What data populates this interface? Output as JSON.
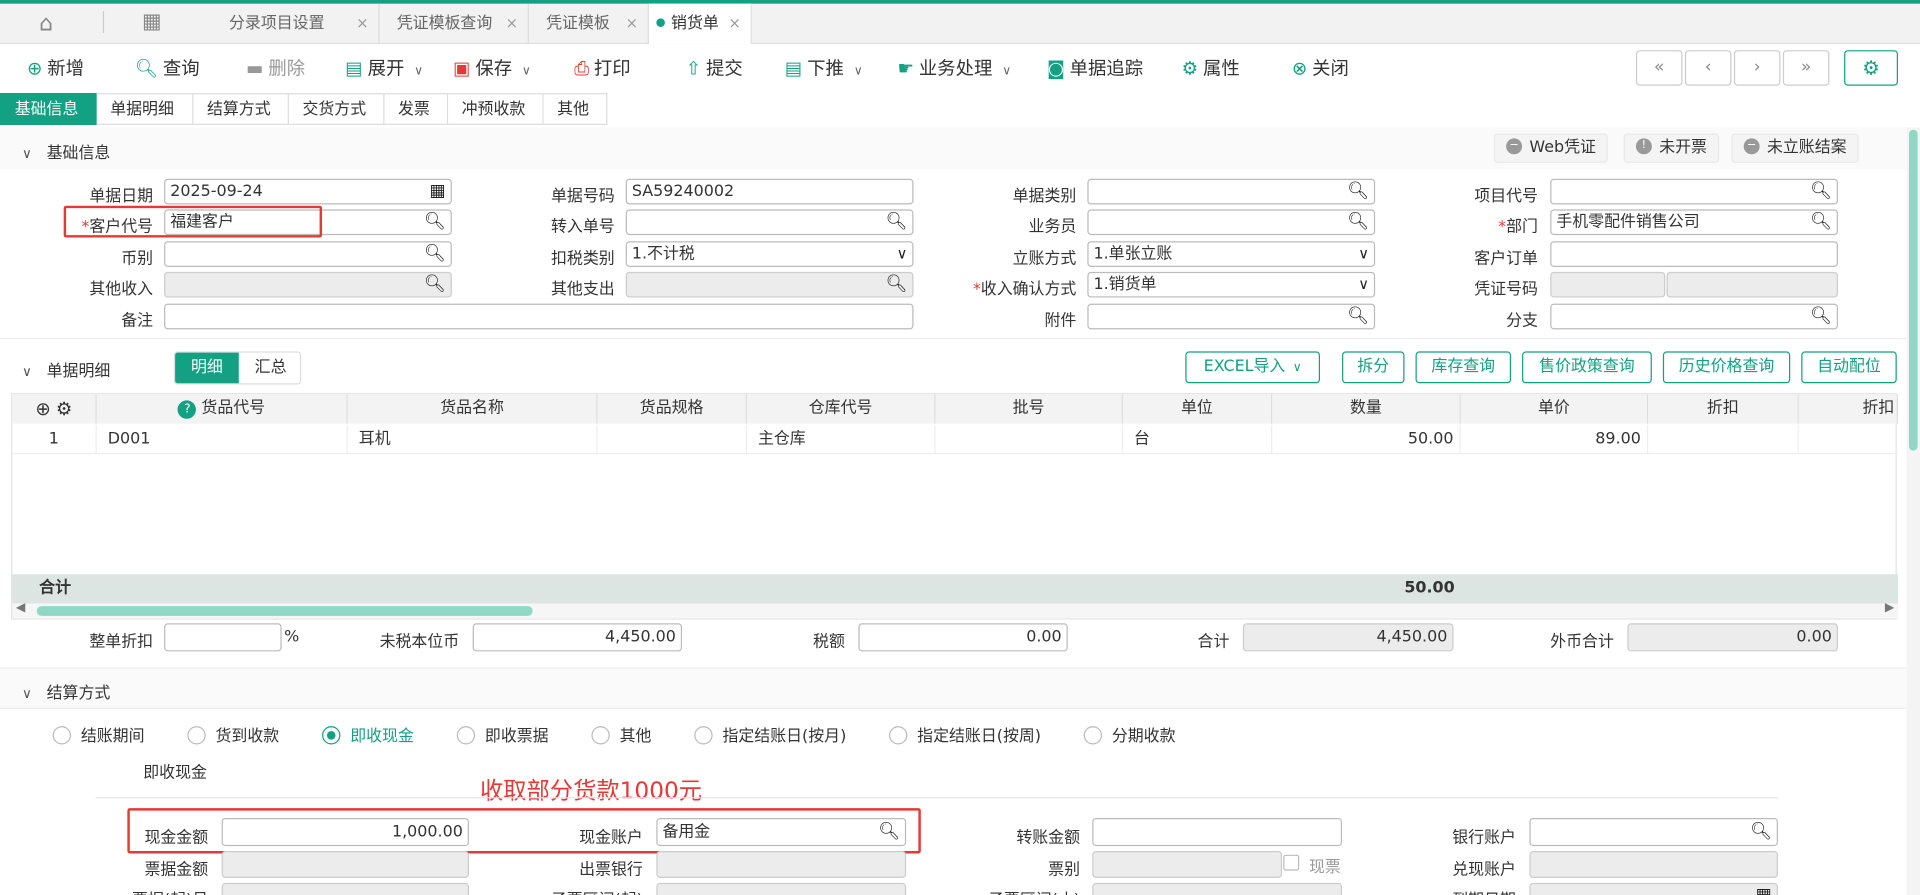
{
  "tabs": [
    {
      "label": "分录项目设置"
    },
    {
      "label": "凭证模板查询"
    },
    {
      "label": "凭证模板"
    },
    {
      "label": "销货单"
    }
  ],
  "toolbar": {
    "new": "新增",
    "query": "查询",
    "delete": "删除",
    "expand": "展开",
    "save": "保存",
    "print": "打印",
    "submit": "提交",
    "push_down": "下推",
    "business": "业务处理",
    "trace": "单据追踪",
    "properties": "属性",
    "close": "关闭"
  },
  "sub_tabs": [
    "基础信息",
    "单据明细",
    "结算方式",
    "交货方式",
    "发票",
    "冲预收款",
    "其他"
  ],
  "basic": {
    "section_title": "基础信息",
    "right_buttons": [
      "Web凭证",
      "未开票",
      "未立账结案"
    ],
    "labels": {
      "doc_date": "单据日期",
      "doc_no": "单据号码",
      "doc_type": "单据类别",
      "project_code": "项目代号",
      "customer_code": "客户代号",
      "transfer_no": "转入单号",
      "salesperson": "业务员",
      "department": "部门",
      "currency": "币别",
      "tax_type": "扣税类别",
      "account_method": "立账方式",
      "customer_order": "客户订单",
      "other_income": "其他收入",
      "other_expense": "其他支出",
      "revenue_confirm": "收入确认方式",
      "voucher_no": "凭证号码",
      "remark": "备注",
      "attachment": "附件",
      "branch": "分支"
    },
    "values": {
      "doc_date": "2025-09-24",
      "doc_no": "SA59240002",
      "customer_code": "福建客户",
      "department": "手机零配件销售公司",
      "tax_type": "1.不计税",
      "account_method": "1.单张立账",
      "revenue_confirm": "1.销货单"
    },
    "required_mark": "*"
  },
  "detail": {
    "section_title": "单据明细",
    "toggle": [
      "明细",
      "汇总"
    ],
    "buttons": [
      "EXCEL导入",
      "拆分",
      "库存查询",
      "售价政策查询",
      "历史价格查询",
      "自动配位"
    ],
    "columns": [
      "货品代号",
      "货品名称",
      "货品规格",
      "仓库代号",
      "批号",
      "单位",
      "数量",
      "单价",
      "折扣",
      "折扣"
    ],
    "rows": [
      {
        "idx": "1",
        "code": "D001",
        "name": "耳机",
        "spec": "",
        "warehouse": "主仓库",
        "batch": "",
        "unit": "台",
        "qty": "50.00",
        "price": "89.00"
      }
    ],
    "total_label": "合计",
    "total_qty": "50.00"
  },
  "summary": {
    "discount_label": "整单折扣",
    "discount_unit": "%",
    "untaxed_label": "未税本位币",
    "untaxed_value": "4,450.00",
    "tax_label": "税额",
    "tax_value": "0.00",
    "total_label": "合计",
    "total_value": "4,450.00",
    "foreign_label": "外币合计",
    "foreign_value": "0.00"
  },
  "settlement": {
    "section_title": "结算方式",
    "options": [
      "结账期间",
      "货到收款",
      "即收现金",
      "即收票据",
      "其他",
      "指定结账日(按月)",
      "指定结账日(按周)",
      "分期收款"
    ],
    "selected": "即收现金",
    "sub_title": "即收现金",
    "annotation": "收取部分货款1000元",
    "labels": {
      "cash_amount": "现金金额",
      "cash_account": "现金账户",
      "transfer_amount": "转账金额",
      "bank_account": "银行账户",
      "bill_amount": "票据金额",
      "issuing_bank": "出票银行",
      "bill_type": "票别",
      "cash_bill": "现票",
      "cash_out_account": "兑现账户",
      "bill_start": "票据(起)号",
      "sub_range_start": "子票区间(起)",
      "sub_range_end": "子票区间(止)",
      "due_date": "到期日期"
    },
    "values": {
      "cash_amount": "1,000.00",
      "cash_account": "备用金"
    }
  },
  "colors": {
    "accent": "#12a182",
    "highlight": "#e53935"
  }
}
